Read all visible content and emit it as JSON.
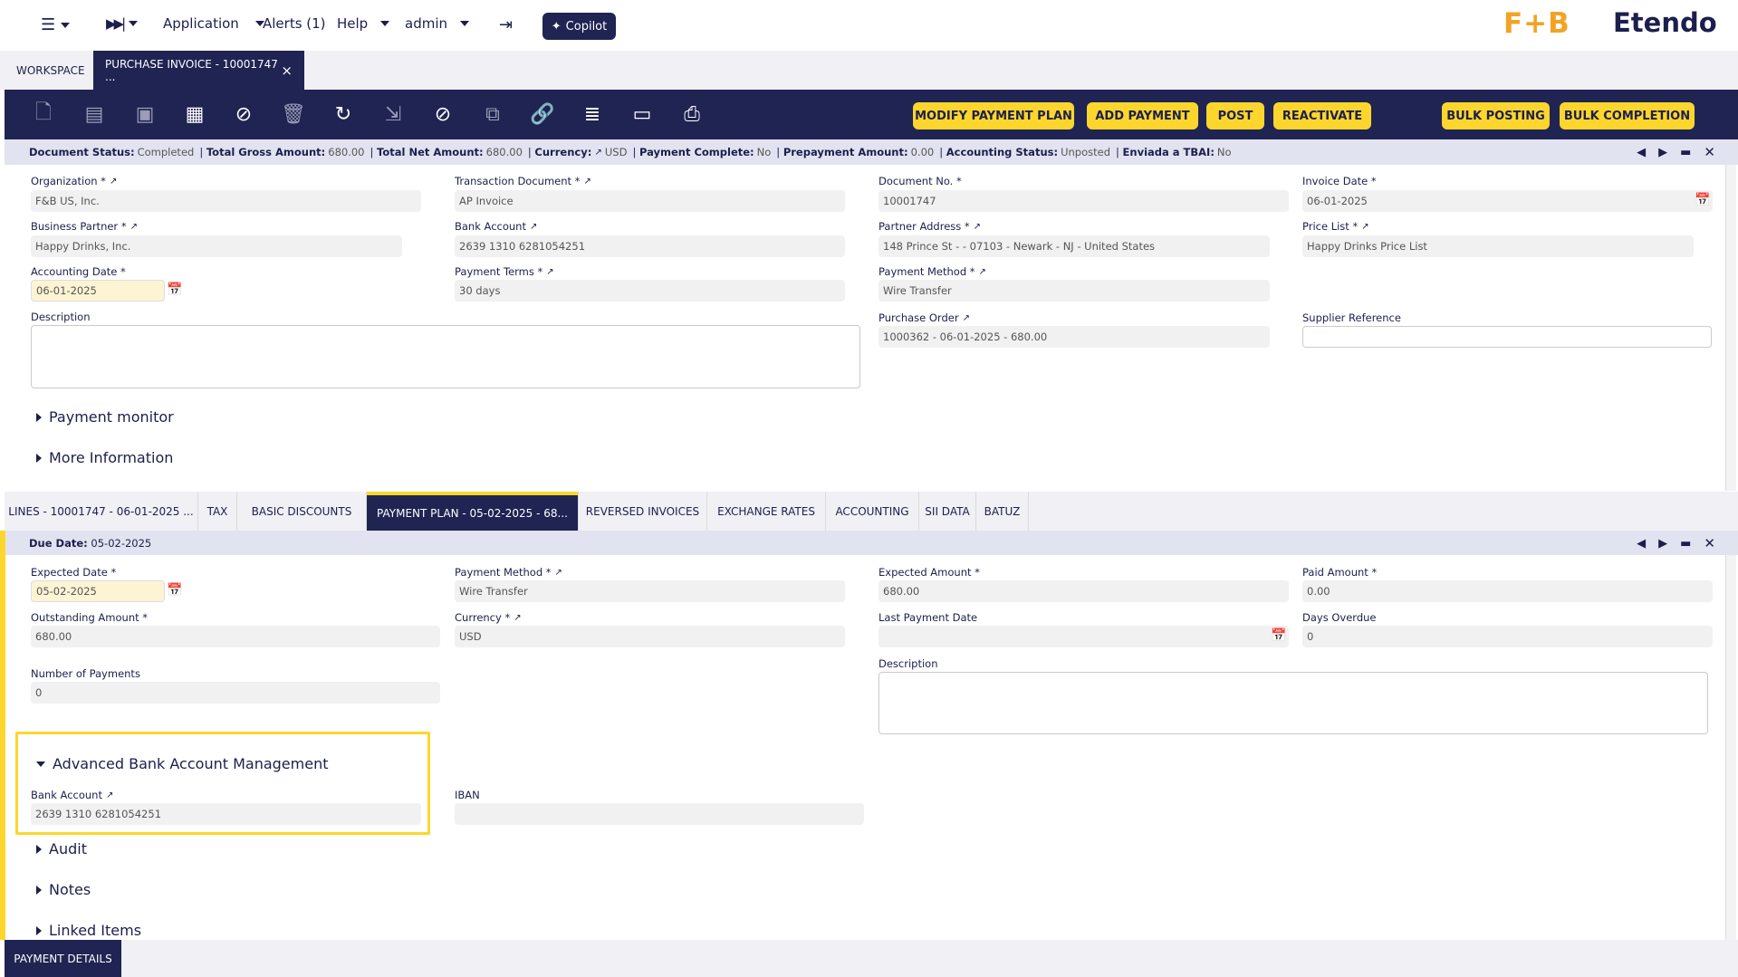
{
  "topbar": {
    "application": "Application",
    "alerts": "Alerts (1)",
    "help": "Help",
    "user": "admin",
    "copilot": "Copilot",
    "logo_fb": "F+B",
    "logo_etendo": "Etendo"
  },
  "tabs": {
    "workspace": "WORKSPACE",
    "active": "PURCHASE INVOICE - 10001747 ...",
    "close": "×"
  },
  "toolbar": {
    "modify_payment_plan": "MODIFY PAYMENT PLAN",
    "add_payment": "ADD PAYMENT",
    "post": "POST",
    "reactivate": "REACTIVATE",
    "bulk_posting": "BULK POSTING",
    "bulk_completion": "BULK COMPLETION"
  },
  "status": {
    "doc_status_label": "Document Status:",
    "doc_status": "Completed",
    "gross_label": "Total Gross Amount:",
    "gross": "680.00",
    "net_label": "Total Net Amount:",
    "net": "680.00",
    "currency_label": "Currency:",
    "currency": "USD",
    "payment_complete_label": "Payment Complete:",
    "payment_complete": "No",
    "prepayment_label": "Prepayment Amount:",
    "prepayment": "0.00",
    "accounting_label": "Accounting Status:",
    "accounting": "Unposted",
    "tbai_label": "Enviada a TBAI:",
    "tbai": "No",
    "sep": "|"
  },
  "header": {
    "organization_label": "Organization *",
    "organization": "F&B US, Inc.",
    "transaction_document_label": "Transaction Document *",
    "transaction_document": "AP Invoice",
    "document_no_label": "Document No. *",
    "document_no": "10001747",
    "invoice_date_label": "Invoice Date *",
    "invoice_date": "06-01-2025",
    "business_partner_label": "Business Partner *",
    "business_partner": "Happy Drinks, Inc.",
    "bank_account_label": "Bank Account",
    "bank_account": "2639 1310 6281054251",
    "partner_address_label": "Partner Address *",
    "partner_address": "148 Prince St -  - 07103 - Newark - NJ - United States",
    "price_list_label": "Price List *",
    "price_list": "Happy Drinks Price List",
    "accounting_date_label": "Accounting Date *",
    "accounting_date": "06-01-2025",
    "payment_terms_label": "Payment Terms *",
    "payment_terms": "30 days",
    "payment_method_label": "Payment Method *",
    "payment_method": "Wire Transfer",
    "description_label": "Description",
    "purchase_order_label": "Purchase Order",
    "purchase_order": "1000362 - 06-01-2025 - 680.00",
    "supplier_reference_label": "Supplier Reference",
    "payment_monitor": "Payment monitor",
    "more_information": "More Information"
  },
  "subtabs": [
    "LINES - 10001747 - 06-01-2025 ...",
    "TAX",
    "BASIC DISCOUNTS",
    "PAYMENT PLAN - 05-02-2025 - 68...",
    "REVERSED INVOICES",
    "EXCHANGE RATES",
    "ACCOUNTING",
    "SII DATA",
    "BATUZ"
  ],
  "plan": {
    "due_date_label": "Due Date:",
    "due_date": "05-02-2025",
    "expected_date_label": "Expected Date *",
    "expected_date": "05-02-2025",
    "payment_method_label": "Payment Method *",
    "payment_method": "Wire Transfer",
    "expected_amount_label": "Expected Amount *",
    "expected_amount": "680.00",
    "paid_amount_label": "Paid Amount *",
    "paid_amount": "0.00",
    "outstanding_label": "Outstanding Amount *",
    "outstanding": "680.00",
    "currency_label": "Currency *",
    "currency": "USD",
    "last_payment_label": "Last Payment Date",
    "days_overdue_label": "Days Overdue",
    "days_overdue": "0",
    "num_payments_label": "Number of Payments",
    "num_payments": "0",
    "description_label": "Description",
    "advanced_section": "Advanced Bank Account Management",
    "bank_account_label": "Bank Account",
    "bank_account": "2639 1310 6281054251",
    "iban_label": "IBAN",
    "audit": "Audit",
    "notes": "Notes",
    "linked_items": "Linked Items"
  },
  "bottom": {
    "payment_details": "PAYMENT DETAILS"
  },
  "colors": {
    "navy": "#202452",
    "yellow": "#fcd62d",
    "status_bg": "#e2e3f0"
  }
}
